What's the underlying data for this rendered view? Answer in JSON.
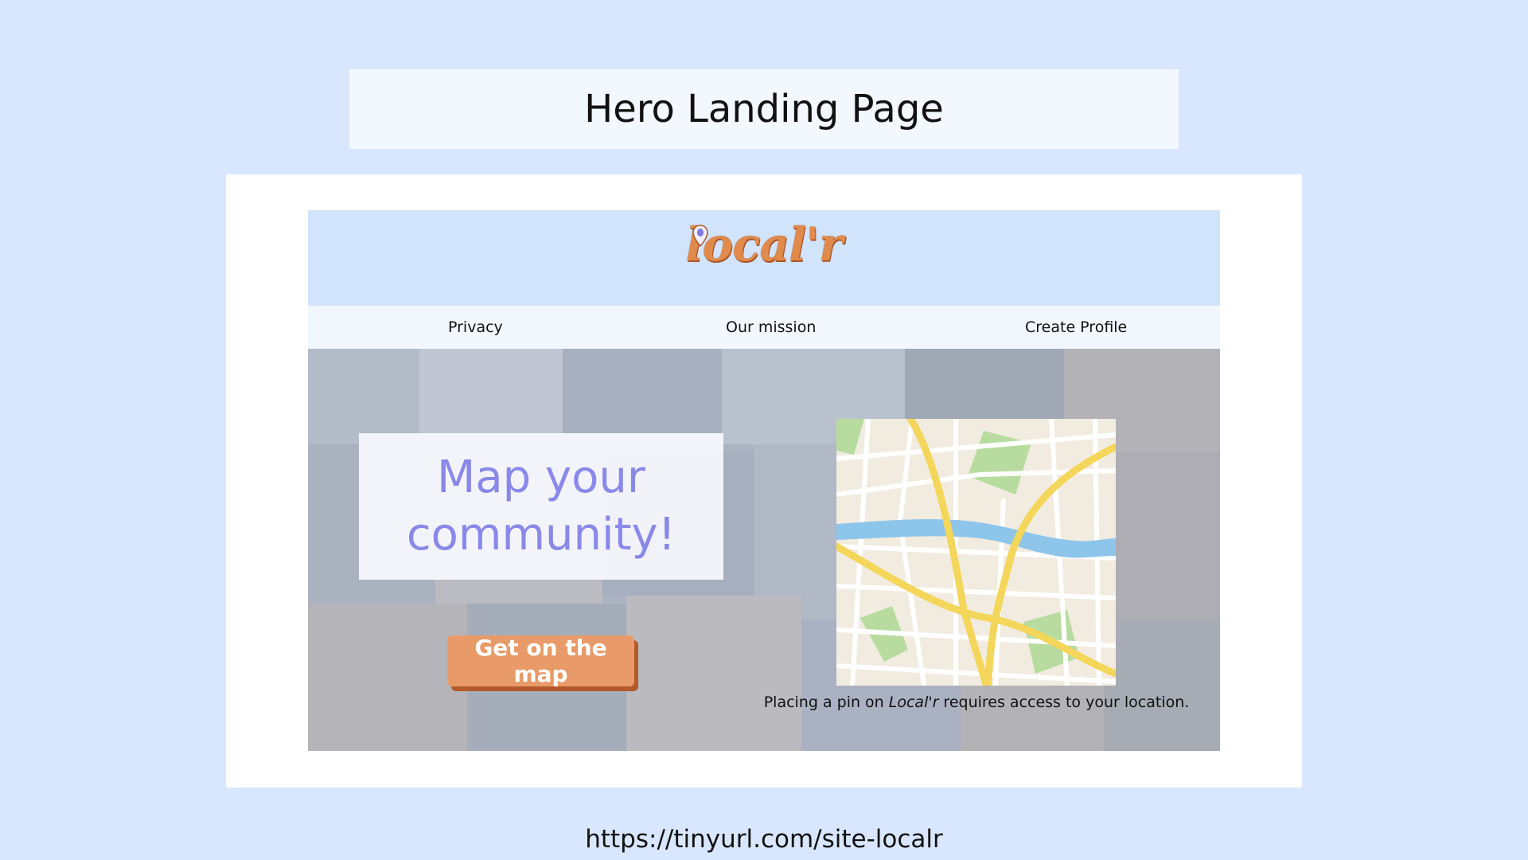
{
  "slide": {
    "title": "Hero Landing Page",
    "url": "https://tinyurl.com/site-localr"
  },
  "site": {
    "logo_text": "local'r",
    "nav": {
      "items": [
        "Privacy",
        "Our mission",
        "Create Profile"
      ]
    },
    "hero": {
      "headline_line1": "Map your",
      "headline_line2": "community!",
      "cta_label": "Get on the map",
      "caption_prefix": "Placing a pin on ",
      "caption_brand": "Local'r",
      "caption_suffix": " requires access to your location."
    }
  },
  "colors": {
    "page_bg": "#d8e7fd",
    "header_bg": "#d2e4fb",
    "accent_orange": "#e89a68",
    "headline_purple": "#8a88e8"
  }
}
